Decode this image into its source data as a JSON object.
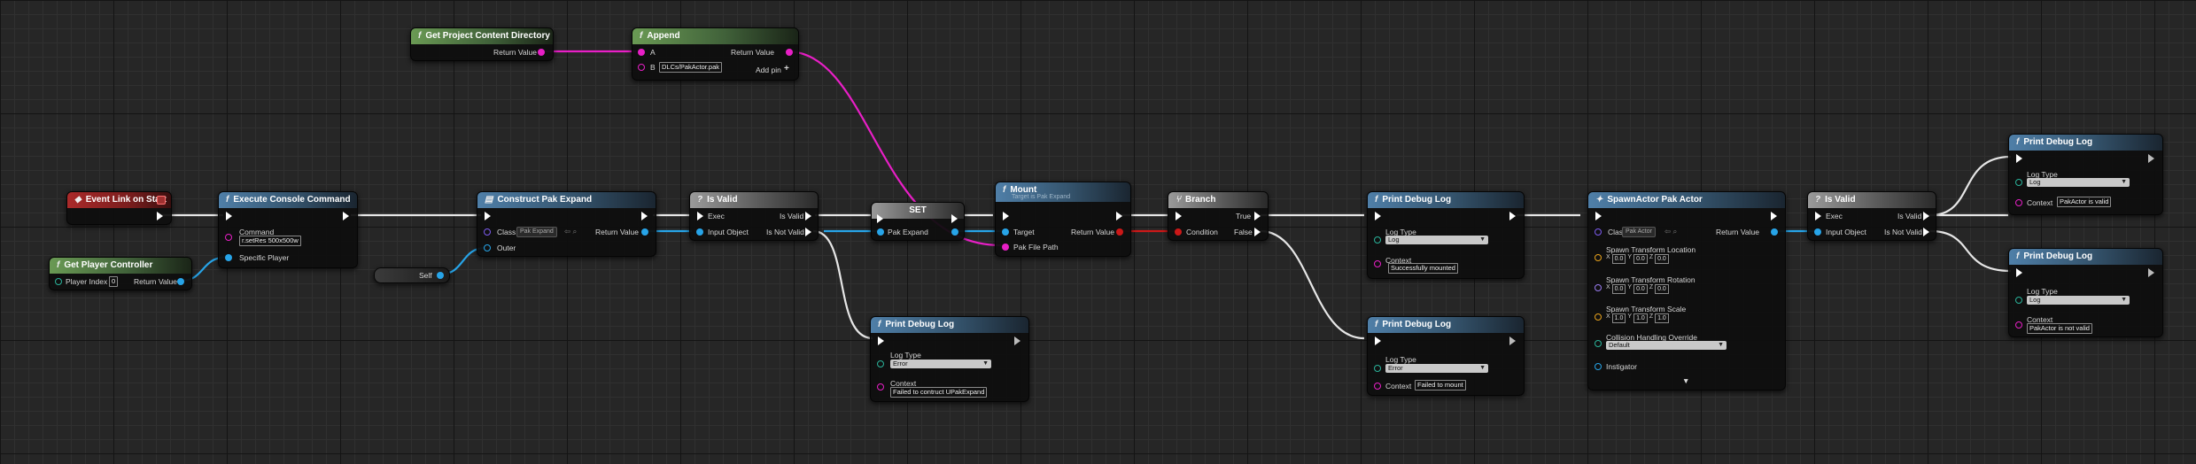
{
  "nodes": {
    "get_project_content_directory": {
      "title": "Get Project Content Directory",
      "return_value": "Return Value"
    },
    "append": {
      "title": "Append",
      "a": "A",
      "b": "B",
      "b_value": "DLCs/PakActor.pak",
      "return_value": "Return Value",
      "add_pin": "Add pin"
    },
    "event_link_on_start": {
      "title": "Event Link on Start"
    },
    "execute_console_command": {
      "title": "Execute Console Command",
      "command": "Command",
      "command_value": "r.setRes 500x500w",
      "specific_player": "Specific Player"
    },
    "get_player_controller": {
      "title": "Get Player Controller",
      "player_index": "Player Index",
      "player_index_value": "0",
      "return_value": "Return Value"
    },
    "construct_pak_expand": {
      "title": "Construct Pak Expand",
      "class": "Class",
      "class_value": "Pak Expand",
      "outer": "Outer",
      "return_value": "Return Value"
    },
    "self": {
      "title": "Self"
    },
    "is_valid_1": {
      "title": "Is Valid",
      "exec": "Exec",
      "input_object": "Input Object",
      "is_valid": "Is Valid",
      "is_not_valid": "Is Not Valid"
    },
    "set": {
      "title": "SET",
      "pak_expand": "Pak Expand"
    },
    "mount": {
      "title": "Mount",
      "subtitle": "Target is Pak Expand",
      "target": "Target",
      "pak_file_path": "Pak File Path",
      "return_value": "Return Value"
    },
    "branch": {
      "title": "Branch",
      "condition": "Condition",
      "true": "True",
      "false": "False"
    },
    "print_debug_log_failed_construct": {
      "title": "Print Debug Log",
      "log_type": "Log Type",
      "log_type_value": "Error",
      "context": "Context",
      "context_value": "Failed to contruct UPakExpand"
    },
    "print_debug_log_success": {
      "title": "Print Debug Log",
      "log_type": "Log Type",
      "log_type_value": "Log",
      "context": "Context",
      "context_value": "Successfully mounted"
    },
    "print_debug_log_failed_mount": {
      "title": "Print Debug Log",
      "log_type": "Log Type",
      "log_type_value": "Error",
      "context": "Context",
      "context_value": "Failed to mount"
    },
    "spawn_actor": {
      "title": "SpawnActor Pak Actor",
      "class": "Class",
      "class_value": "Pak Actor",
      "location": "Spawn Transform Location",
      "rotation": "Spawn Transform Rotation",
      "scale": "Spawn Transform Scale",
      "axis_x": "X",
      "axis_y": "Y",
      "axis_z": "Z",
      "loc": [
        "0.0",
        "0.0",
        "0.0"
      ],
      "rot": [
        "0.0",
        "0.0",
        "0.0"
      ],
      "scl": [
        "1.0",
        "1.0",
        "1.0"
      ],
      "collision": "Collision Handling Override",
      "collision_value": "Default",
      "instigator": "Instigator",
      "return_value": "Return Value",
      "expand": "▼"
    },
    "is_valid_2": {
      "title": "Is Valid",
      "exec": "Exec",
      "input_object": "Input Object",
      "is_valid": "Is Valid",
      "is_not_valid": "Is Not Valid"
    },
    "print_debug_log_valid": {
      "title": "Print Debug Log",
      "log_type": "Log Type",
      "log_type_value": "Log",
      "context": "Context",
      "context_value": "PakActor is valid"
    },
    "print_debug_log_not_valid": {
      "title": "Print Debug Log",
      "log_type": "Log Type",
      "log_type_value": "Log",
      "context": "Context",
      "context_value": "PakActor is not valid"
    }
  },
  "colors": {
    "exec_wire": "#ffffff",
    "string_wire": "#e81fc6",
    "object_wire": "#27a4e8",
    "function_header": "#4f7fa8",
    "pure_header": "#6a9a54",
    "event_header": "#aa2a2a",
    "boolean_wire": "#cc1818"
  },
  "icons": {
    "function": "f-icon",
    "event": "event-diamond-icon",
    "exec": "exec-arrow-icon",
    "dropdown": "chevron-down-icon"
  }
}
